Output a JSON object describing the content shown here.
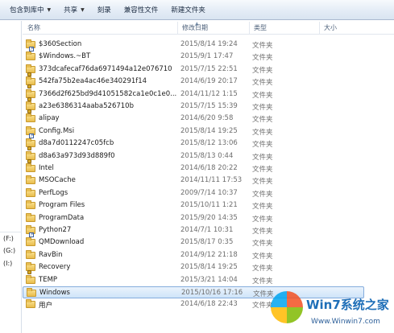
{
  "toolbar": {
    "include_library": "包含到库中",
    "share": "共享",
    "burn": "刻录",
    "compat_files": "兼容性文件",
    "new_folder": "新建文件夹"
  },
  "nav": {
    "drives": [
      "(F:)",
      "(G:)",
      "(I:)"
    ]
  },
  "columns": {
    "name": "名称",
    "modified": "修改日期",
    "type": "类型",
    "size": "大小"
  },
  "files": [
    {
      "name": "$360Section",
      "date": "2015/8/14 19:24",
      "type": "文件夹",
      "icon": "shortcut"
    },
    {
      "name": "$Windows.~BT",
      "date": "2015/9/1 17:47",
      "type": "文件夹",
      "icon": "folder"
    },
    {
      "name": "373dcafecaf76da6971494a12e076710",
      "date": "2015/7/15 22:51",
      "type": "文件夹",
      "icon": "locked"
    },
    {
      "name": "542fa75b2ea4ac46e340291f14",
      "date": "2014/6/19 20:17",
      "type": "文件夹",
      "icon": "locked"
    },
    {
      "name": "7366d2f625bd9d41051582ca1e0c1e0...",
      "date": "2014/11/12 1:15",
      "type": "文件夹",
      "icon": "locked"
    },
    {
      "name": "a23e6386314aaba526710b",
      "date": "2015/7/15 15:39",
      "type": "文件夹",
      "icon": "locked"
    },
    {
      "name": "alipay",
      "date": "2014/6/20 9:58",
      "type": "文件夹",
      "icon": "folder"
    },
    {
      "name": "Config.Msi",
      "date": "2015/8/14 19:25",
      "type": "文件夹",
      "icon": "shortcut"
    },
    {
      "name": "d8a7d0112247c05fcb",
      "date": "2015/8/12 13:06",
      "type": "文件夹",
      "icon": "locked"
    },
    {
      "name": "d8a63a973d93d889f0",
      "date": "2015/8/13 0:44",
      "type": "文件夹",
      "icon": "locked"
    },
    {
      "name": "Intel",
      "date": "2014/6/18 20:22",
      "type": "文件夹",
      "icon": "folder"
    },
    {
      "name": "MSOCache",
      "date": "2014/11/11 17:53",
      "type": "文件夹",
      "icon": "folder"
    },
    {
      "name": "PerfLogs",
      "date": "2009/7/14 10:37",
      "type": "文件夹",
      "icon": "folder"
    },
    {
      "name": "Program Files",
      "date": "2015/10/11 1:21",
      "type": "文件夹",
      "icon": "folder"
    },
    {
      "name": "ProgramData",
      "date": "2015/9/20 14:35",
      "type": "文件夹",
      "icon": "folder"
    },
    {
      "name": "Python27",
      "date": "2014/7/1 10:31",
      "type": "文件夹",
      "icon": "shortcut"
    },
    {
      "name": "QMDownload",
      "date": "2015/8/17 0:35",
      "type": "文件夹",
      "icon": "folder"
    },
    {
      "name": "RavBin",
      "date": "2014/9/12 21:18",
      "type": "文件夹",
      "icon": "folder"
    },
    {
      "name": "Recovery",
      "date": "2015/8/14 19:25",
      "type": "文件夹",
      "icon": "locked"
    },
    {
      "name": "TEMP",
      "date": "2015/3/21 14:04",
      "type": "文件夹",
      "icon": "folder"
    },
    {
      "name": "Windows",
      "date": "2015/10/16 17:16",
      "type": "文件夹",
      "icon": "folder",
      "selected": true
    },
    {
      "name": "用户",
      "date": "2014/6/18 22:43",
      "type": "文件夹",
      "icon": "folder"
    }
  ],
  "watermark": {
    "title": "Win7系统之家",
    "url": "Www.Winwin7.com"
  }
}
